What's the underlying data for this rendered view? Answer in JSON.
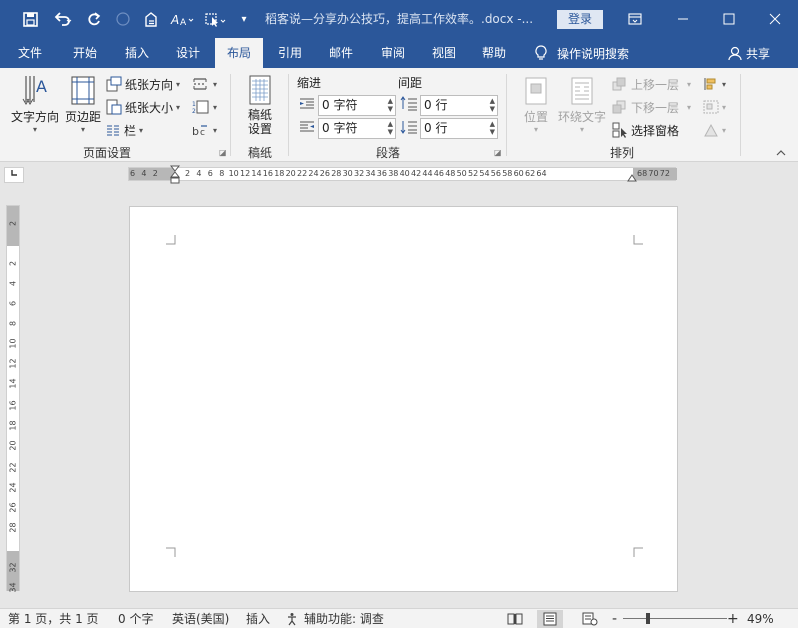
{
  "titlebar": {
    "title": "稻客说—分享办公技巧，提高工作效率。.docx  -...",
    "login": "登录",
    "quick_access_icons": [
      "save-icon",
      "undo-icon",
      "redo-icon",
      "circle-icon",
      "document-icon",
      "font-size-icon",
      "cursor-icon",
      "dropdown-icon"
    ],
    "window_controls": [
      "ribbon-display-icon",
      "minimize-icon",
      "maximize-icon",
      "close-icon"
    ]
  },
  "tabs": {
    "items": [
      "文件",
      "开始",
      "插入",
      "设计",
      "布局",
      "引用",
      "邮件",
      "审阅",
      "视图",
      "帮助"
    ],
    "active": "布局",
    "tell_me": "操作说明搜索",
    "share": "共享"
  },
  "ribbon": {
    "page_setup": {
      "label": "页面设置",
      "text_direction": "文字方向",
      "margins": "页边距",
      "orientation": "纸张方向",
      "size": "纸张大小",
      "columns": "栏"
    },
    "manuscript": {
      "label": "稿纸",
      "button": "稿纸\n设置",
      "button_line1": "稿纸",
      "button_line2": "设置"
    },
    "paragraph": {
      "label": "段落",
      "indent_title": "缩进",
      "spacing_title": "间距",
      "indent_left": "0 字符",
      "indent_right": "0 字符",
      "spacing_before": "0 行",
      "spacing_after": "0 行"
    },
    "arrange": {
      "label": "排列",
      "position": "位置",
      "wrap_text": "环绕文字",
      "bring_forward": "上移一层",
      "send_backward": "下移一层",
      "selection_pane": "选择窗格"
    }
  },
  "ruler": {
    "h_ticks_left": [
      "6",
      "4",
      "2"
    ],
    "h_ticks": [
      "2",
      "4",
      "6",
      "8",
      "10",
      "12",
      "14",
      "16",
      "18",
      "20",
      "22",
      "24",
      "26",
      "28",
      "30",
      "32",
      "34",
      "36",
      "38",
      "40",
      "42",
      "44",
      "46",
      "48",
      "50",
      "52",
      "54",
      "56",
      "58",
      "60",
      "62",
      "64"
    ],
    "h_ticks_right": [
      "68",
      "70",
      "72"
    ],
    "v_ticks": [
      "2",
      "2",
      "4",
      "6",
      "8",
      "10",
      "12",
      "14",
      "16",
      "18",
      "20",
      "22",
      "24",
      "26",
      "28",
      "32",
      "34"
    ]
  },
  "statusbar": {
    "page": "第 1 页，共 1 页",
    "words": "0 个字",
    "language": "英语(美国)",
    "mode": "插入",
    "accessibility": "辅助功能: 调查",
    "zoom": "49%",
    "zoom_minus": "-",
    "zoom_plus": "+"
  }
}
